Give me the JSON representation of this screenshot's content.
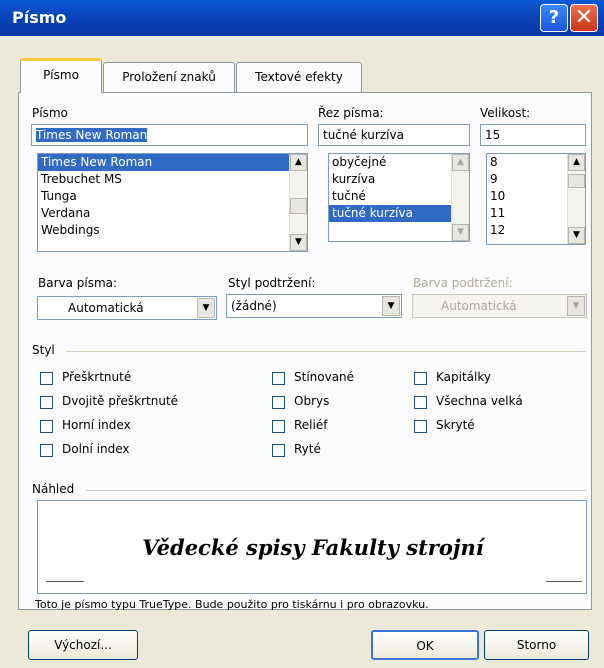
{
  "window": {
    "title": "Písmo",
    "help_glyph": "?",
    "close_glyph": "✕"
  },
  "tabs": [
    "Písmo",
    "Proložení znaků",
    "Textové efekty"
  ],
  "font": {
    "label": "Písmo",
    "value": "Times New Roman",
    "items": [
      "Times New Roman",
      "Trebuchet MS",
      "Tunga",
      "Verdana",
      "Webdings"
    ],
    "selected": "Times New Roman"
  },
  "style": {
    "label": "Řez písma:",
    "value": "tučné kurzíva",
    "items": [
      "obyčejné",
      "kurzíva",
      "tučné",
      "tučné kurzíva"
    ],
    "selected": "tučné kurzíva"
  },
  "size": {
    "label": "Velikost:",
    "value": "15",
    "items": [
      "8",
      "9",
      "10",
      "11",
      "12"
    ]
  },
  "color": {
    "label": "Barva písma:",
    "value": "Automatická"
  },
  "underline": {
    "label": "Styl podtržení:",
    "value": "(žádné)"
  },
  "underline_color": {
    "label": "Barva podtržení:",
    "value": "Automatická",
    "enabled": false
  },
  "effects": {
    "title": "Styl",
    "col1": [
      "Přeškrtnuté",
      "Dvojitě přeškrtnuté",
      "Horní index",
      "Dolní index"
    ],
    "col2": [
      "Stínované",
      "Obrys",
      "Reliéf",
      "Ryté"
    ],
    "col3": [
      "Kapitálky",
      "Všechna velká",
      "Skryté"
    ]
  },
  "preview": {
    "title": "Náhled",
    "sample": "Vědecké spisy Fakulty strojní",
    "note": "Toto je písmo typu TrueType. Bude použito pro tiskárnu i pro obrazovku."
  },
  "buttons": {
    "default": "Výchozí...",
    "ok": "OK",
    "cancel": "Storno"
  },
  "icons": {
    "scroll_up": "▲",
    "scroll_down": "▼"
  },
  "colors": {
    "titlebar": "#0a5ad8",
    "selection": "#316ac5",
    "dialog_bg": "#ece9d8"
  }
}
